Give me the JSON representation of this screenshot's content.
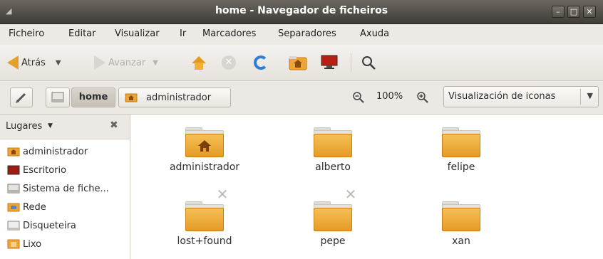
{
  "window": {
    "title": "home - Navegador de ficheiros"
  },
  "menu": {
    "items": [
      {
        "label": "Ficheiro"
      },
      {
        "label": "Editar"
      },
      {
        "label": "Visualizar"
      },
      {
        "label": "Ir"
      },
      {
        "label": "Marcadores"
      },
      {
        "label": "Separadores"
      },
      {
        "label": "Axuda"
      }
    ]
  },
  "toolbar": {
    "back_label": "Atrás",
    "forward_label": "Avanzar"
  },
  "location": {
    "crumbs": [
      "home",
      "administrador"
    ],
    "zoom": "100%",
    "view_mode": "Visualización de iconas"
  },
  "sidebar": {
    "header": "Lugares",
    "items": [
      {
        "label": "administrador",
        "icon": "home-folder-icon"
      },
      {
        "label": "Escritorio",
        "icon": "desktop-icon"
      },
      {
        "label": "Sistema de fiche...",
        "icon": "filesystem-icon"
      },
      {
        "label": "Rede",
        "icon": "network-icon"
      },
      {
        "label": "Disqueteira",
        "icon": "floppy-icon"
      },
      {
        "label": "Lixo",
        "icon": "trash-icon"
      }
    ]
  },
  "files": [
    {
      "name": "administrador",
      "type": "home-folder"
    },
    {
      "name": "alberto",
      "type": "folder"
    },
    {
      "name": "felipe",
      "type": "folder"
    },
    {
      "name": "lost+found",
      "type": "folder-locked"
    },
    {
      "name": "pepe",
      "type": "folder-locked"
    },
    {
      "name": "xan",
      "type": "folder"
    }
  ],
  "colors": {
    "folder": "#f0ad3a",
    "accent": "#2d7fd6",
    "titlebar": "#4a4742"
  }
}
